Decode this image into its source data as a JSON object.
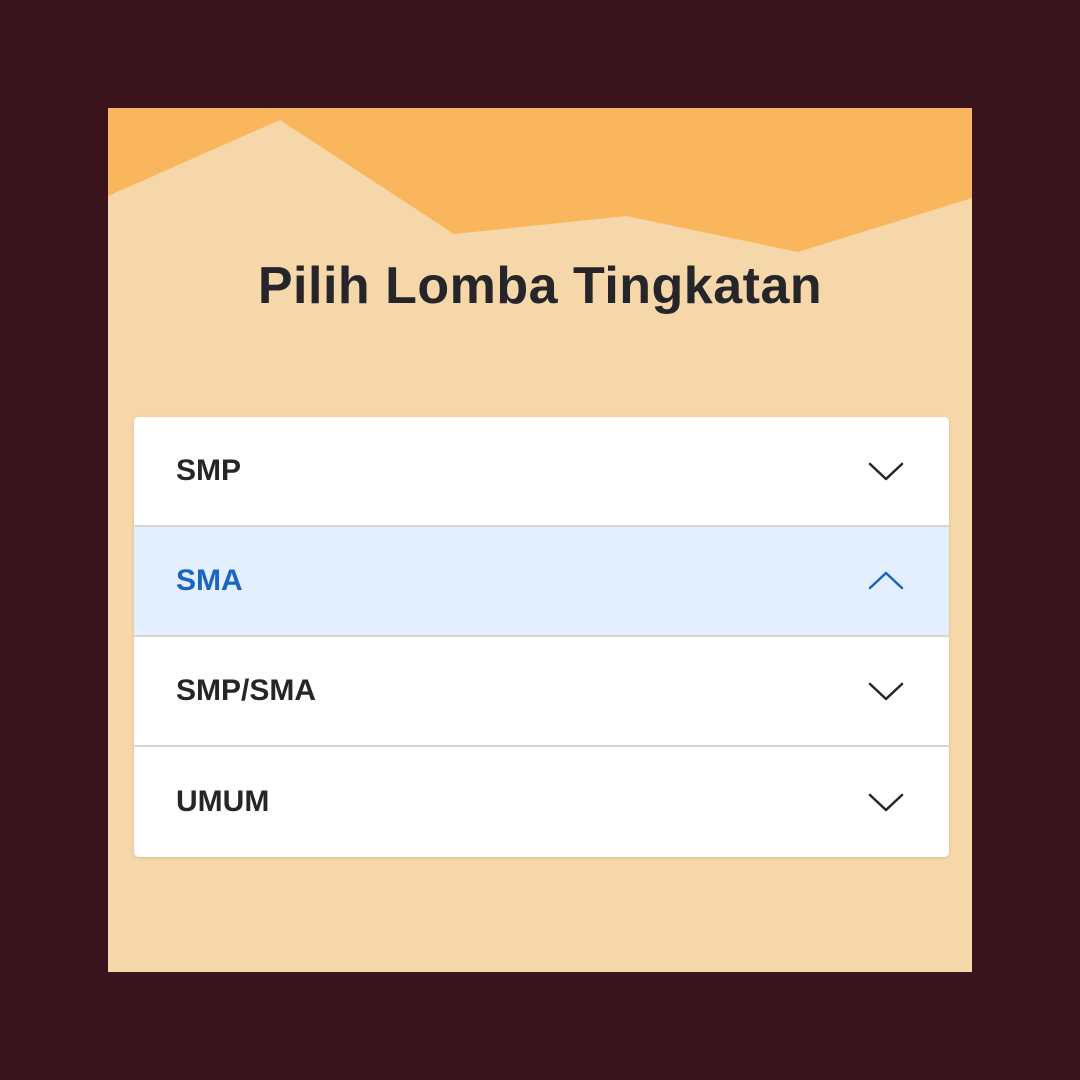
{
  "page": {
    "title": "Pilih Lomba Tingkatan"
  },
  "colors": {
    "outer_background": "#3a141c",
    "card_background": "#f5d7a9",
    "header_wave": "#f9b65c",
    "active_row": "#e4effd",
    "active_text": "#1b64c2",
    "text": "#26262a"
  },
  "accordion": {
    "items": [
      {
        "label": "SMP",
        "expanded": false,
        "icon": "chevron-down-icon"
      },
      {
        "label": "SMA",
        "expanded": true,
        "icon": "chevron-up-icon"
      },
      {
        "label": "SMP/SMA",
        "expanded": false,
        "icon": "chevron-down-icon"
      },
      {
        "label": "UMUM",
        "expanded": false,
        "icon": "chevron-down-icon"
      }
    ]
  }
}
